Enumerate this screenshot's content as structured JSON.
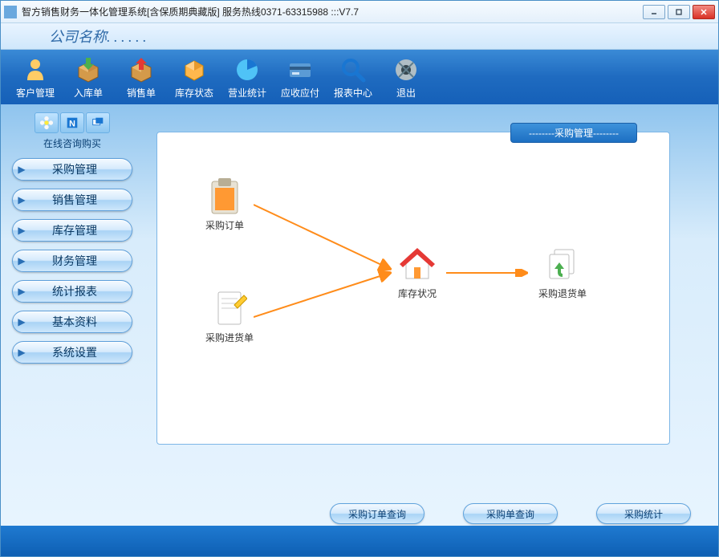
{
  "window": {
    "title": "智方销售财务一体化管理系统[含保质期典藏版] 服务热线0371-63315988 :::V7.7"
  },
  "header": {
    "company": "公司名称. . . . . ."
  },
  "toolbar": [
    {
      "label": "客户管理",
      "icon": "user-icon"
    },
    {
      "label": "入库单",
      "icon": "inbox-icon"
    },
    {
      "label": "销售单",
      "icon": "outbox-icon"
    },
    {
      "label": "库存状态",
      "icon": "cube-icon"
    },
    {
      "label": "营业统计",
      "icon": "pie-icon"
    },
    {
      "label": "应收应付",
      "icon": "card-icon"
    },
    {
      "label": "报表中心",
      "icon": "magnify-icon"
    },
    {
      "label": "退出",
      "icon": "exit-icon"
    }
  ],
  "sidebar": {
    "quick_label": "在线咨询购买",
    "items": [
      {
        "label": "采购管理"
      },
      {
        "label": "销售管理"
      },
      {
        "label": "库存管理"
      },
      {
        "label": "财务管理"
      },
      {
        "label": "统计报表"
      },
      {
        "label": "基本资料"
      },
      {
        "label": "系统设置"
      }
    ]
  },
  "panel": {
    "title": "--------采购管理--------",
    "nodes": {
      "order": {
        "label": "采购订单"
      },
      "receipt": {
        "label": "采购进货单"
      },
      "stock": {
        "label": "库存状况"
      },
      "return": {
        "label": "采购退货单"
      }
    }
  },
  "actions": [
    {
      "label": "采购订单查询"
    },
    {
      "label": "采购单查询"
    },
    {
      "label": "采购统计"
    }
  ]
}
